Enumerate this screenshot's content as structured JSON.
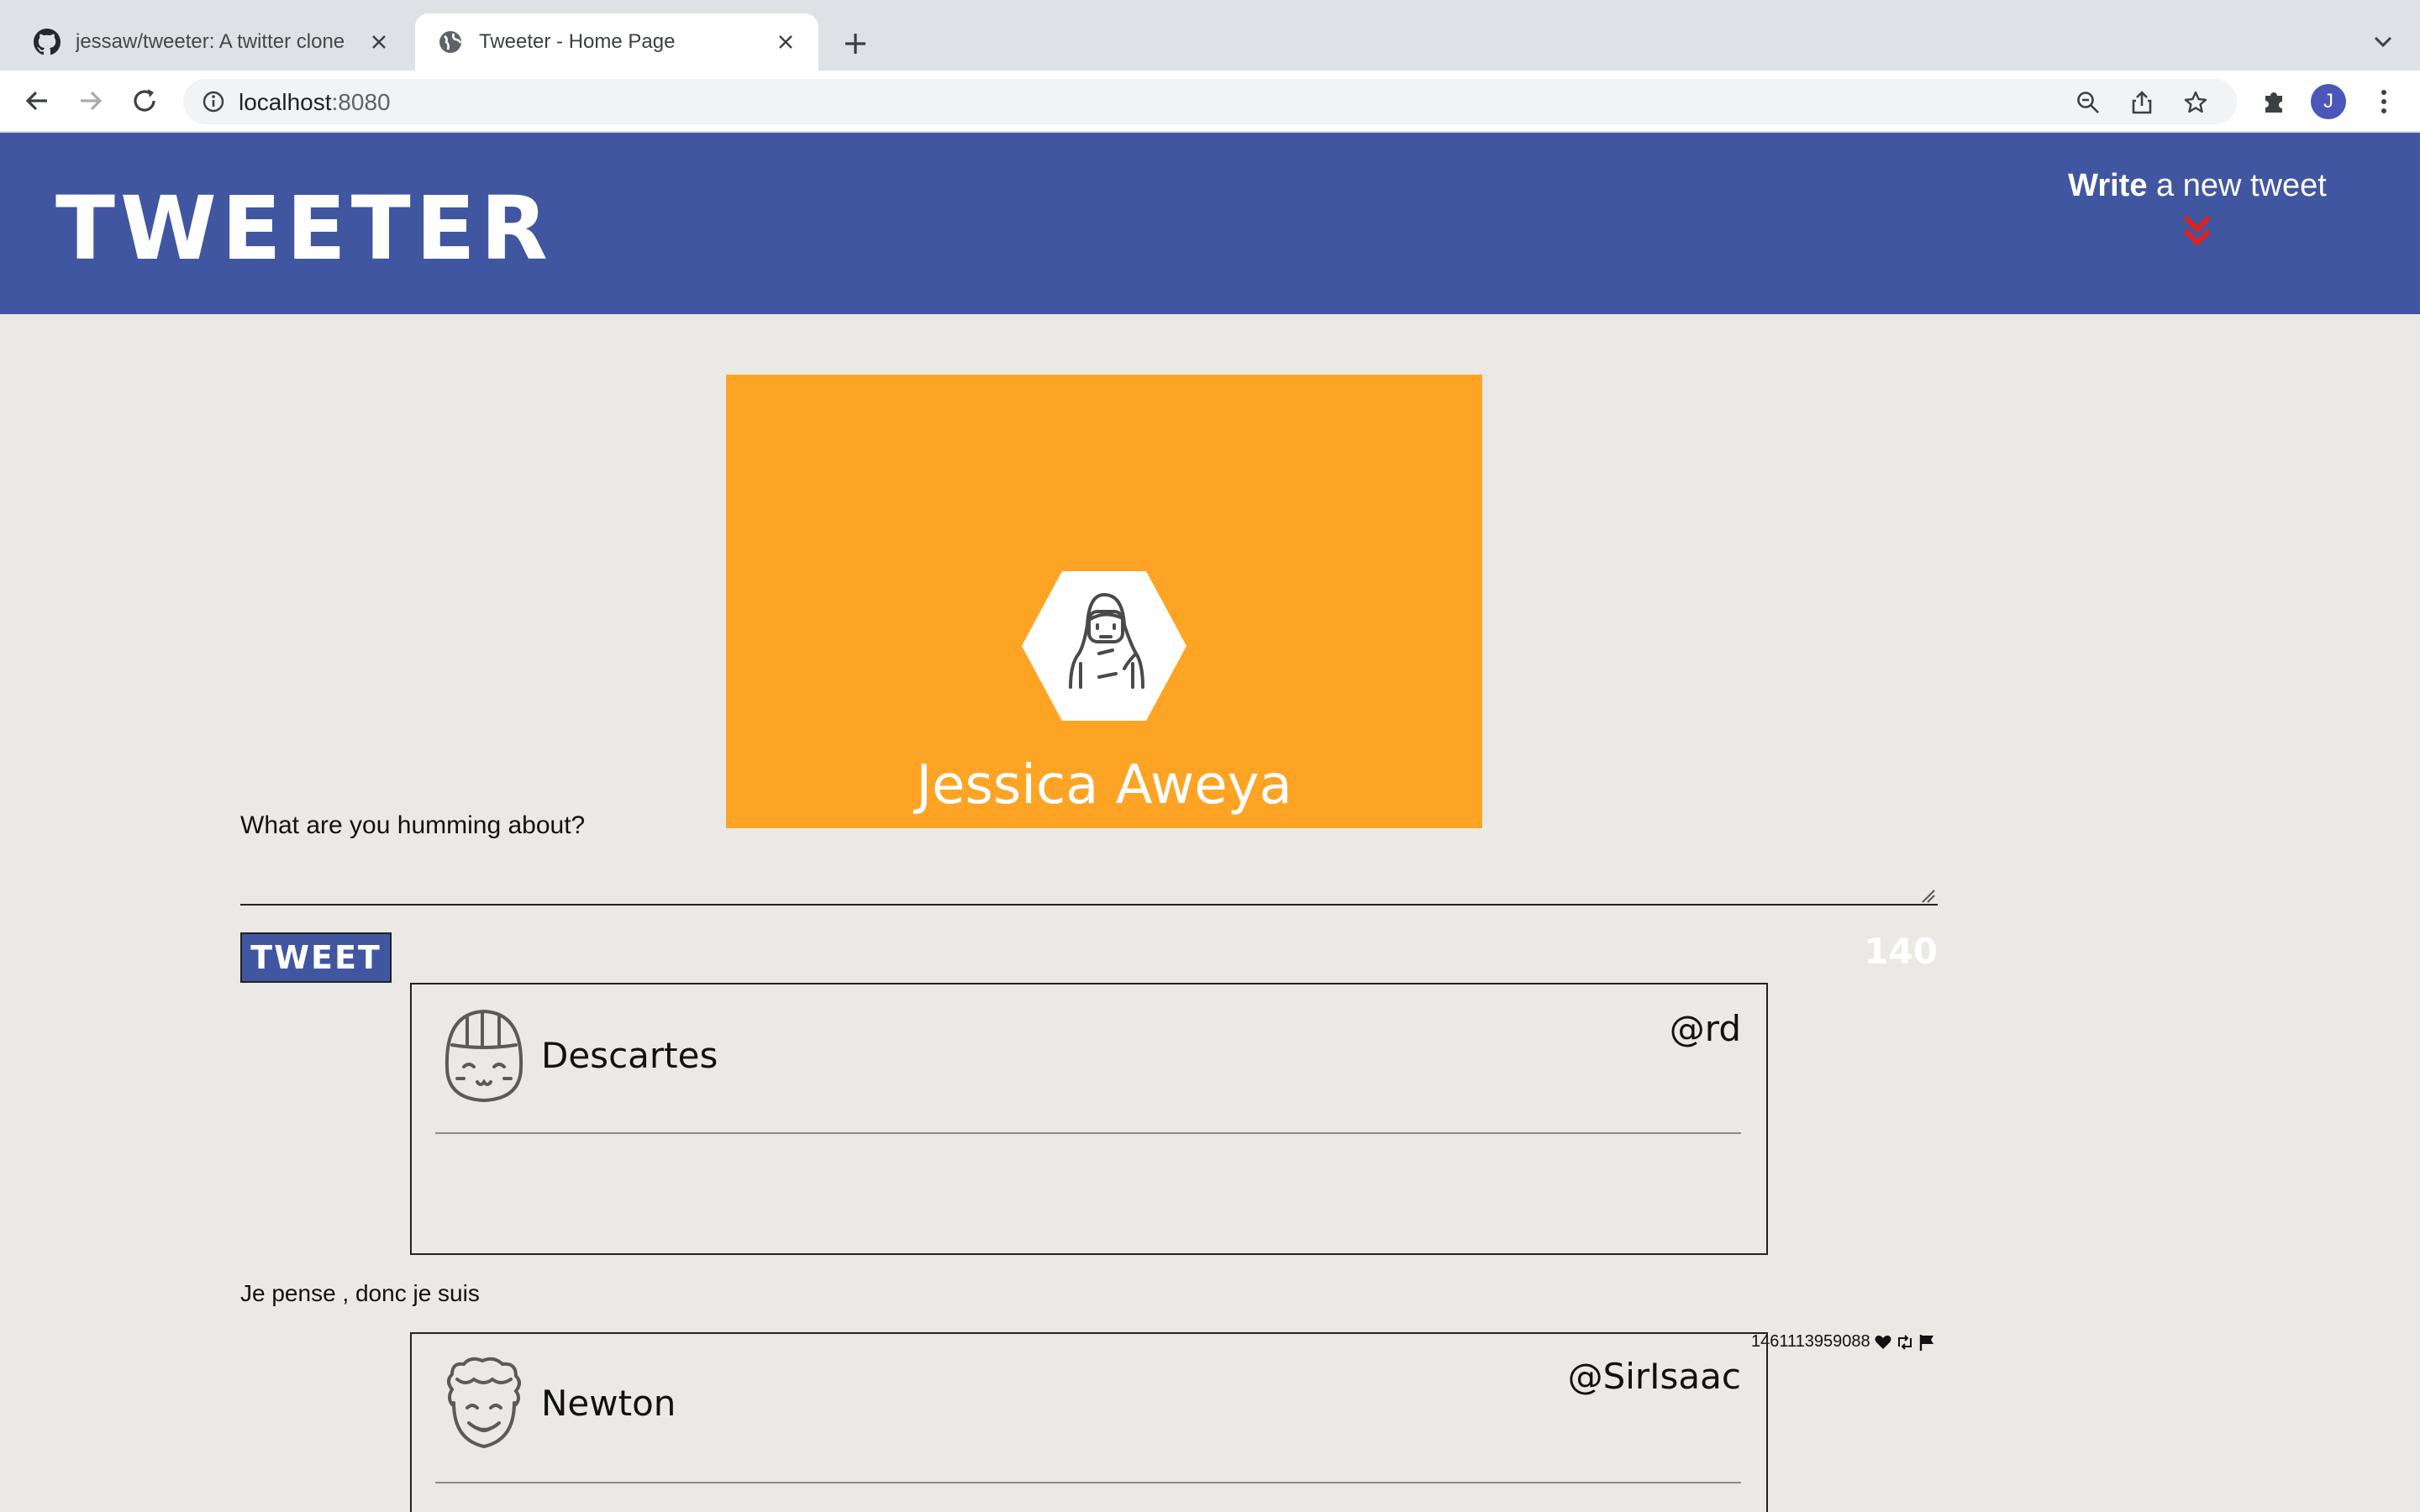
{
  "browser": {
    "tabs": [
      {
        "title": "jessaw/tweeter: A twitter clone",
        "icon": "github-icon",
        "active": false
      },
      {
        "title": "Tweeter - Home Page",
        "icon": "globe-icon",
        "active": true
      }
    ],
    "address": {
      "host": "localhost",
      "port": ":8080"
    },
    "profile_initial": "J"
  },
  "header": {
    "logo": "TWEETER",
    "compose_toggle": {
      "bold": "Write",
      "rest": " a new tweet"
    }
  },
  "profile": {
    "name": "Jessica Aweya"
  },
  "compose": {
    "label": "What are you humming about?",
    "value": "",
    "button": "TWEET",
    "counter": "140"
  },
  "tweets": [
    {
      "name": "Descartes",
      "handle": "@rd",
      "content": "Je pense , donc je suis",
      "timestamp": "1461113959088"
    },
    {
      "name": "Newton",
      "handle": "@SirIsaac",
      "content": "",
      "timestamp": ""
    }
  ],
  "colors": {
    "header_bg": "#4156a1",
    "profile_bg": "#fea425",
    "page_bg": "#ebe9e5",
    "chevron": "#e0211e"
  }
}
